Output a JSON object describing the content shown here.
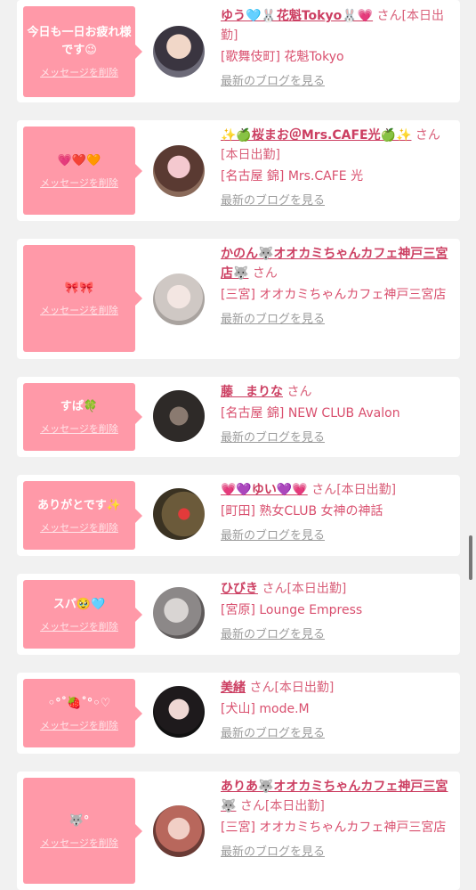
{
  "cards": [
    {
      "message": "今日も一日お疲れ様です😉",
      "delete_label": "メッセージを削除",
      "name": "ゆう🩵🐰花魁Tokyo🐰💗",
      "honorific": "さん",
      "status": "[本日出勤]",
      "shop": "[歌舞伎町] 花魁Tokyo",
      "blog_link": "最新のブログを見る"
    },
    {
      "message": "💗❤️🧡",
      "delete_label": "メッセージを削除",
      "name": "✨🍏桜まお＠Mrs.CAFE光🍏✨",
      "honorific": "さん",
      "status": "[本日出勤]",
      "shop": "[名古屋 錦] Mrs.CAFE 光",
      "blog_link": "最新のブログを見る"
    },
    {
      "message": "🎀🎀",
      "delete_label": "メッセージを削除",
      "name": "かのん🐺オオカミちゃんカフェ神戸三宮店🐺",
      "honorific": "さん",
      "status": "",
      "shop": "[三宮] オオカミちゃんカフェ神戸三宮店",
      "blog_link": "最新のブログを見る"
    },
    {
      "message": "すぱ🍀",
      "delete_label": "メッセージを削除",
      "name": "藤　まりな",
      "honorific": "さん",
      "status": "",
      "shop": "[名古屋 錦] NEW CLUB Avalon",
      "blog_link": "最新のブログを見る"
    },
    {
      "message": "ありがとです✨",
      "delete_label": "メッセージを削除",
      "name": "💗💜ゆい💜💗",
      "honorific": "さん",
      "status": "[本日出勤]",
      "shop": "[町田] 熟女CLUB 女神の神話",
      "blog_link": "最新のブログを見る"
    },
    {
      "message": "スパ🥹🩵",
      "delete_label": "メッセージを削除",
      "name": "ひびき",
      "honorific": "さん",
      "status": "[本日出勤]",
      "shop": "[宮原] Lounge Empress",
      "blog_link": "最新のブログを見る"
    },
    {
      "message": "◦°˚🍓˚°◦♡",
      "delete_label": "メッセージを削除",
      "name": "美緒",
      "honorific": "さん",
      "status": "[本日出勤]",
      "shop": "[犬山] mode.M",
      "blog_link": "最新のブログを見る"
    },
    {
      "message": "🐺°",
      "delete_label": "メッセージを削除",
      "name": "ありあ🐺オオカミちゃんカフェ神戸三宮🐺",
      "honorific": "さん",
      "status": "[本日出勤]",
      "shop": "[三宮] オオカミちゃんカフェ神戸三宮店",
      "blog_link": "最新のブログを見る"
    }
  ],
  "colors": {
    "background": "#f1f1f1",
    "card": "#ffffff",
    "bubble": "#ff99a8",
    "name_link": "#cc3f62",
    "shop_text": "#d94f6e",
    "blog_link": "#9c9c9c"
  }
}
